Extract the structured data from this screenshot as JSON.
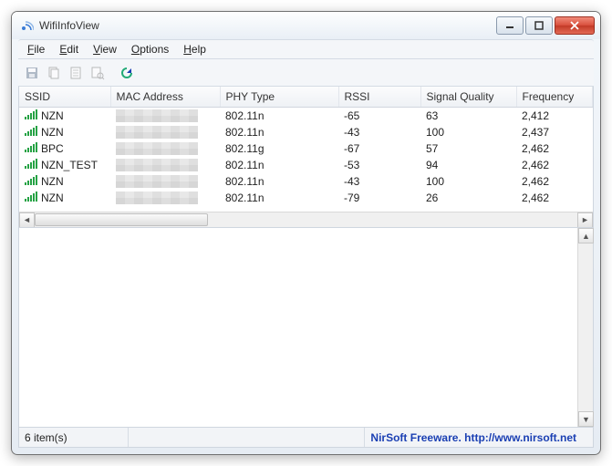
{
  "window": {
    "title": "WifiInfoView"
  },
  "menu": {
    "file": "File",
    "edit": "Edit",
    "view": "View",
    "options": "Options",
    "help": "Help"
  },
  "columns": {
    "ssid": "SSID",
    "mac": "MAC Address",
    "phy": "PHY Type",
    "rssi": "RSSI",
    "quality": "Signal Quality",
    "freq": "Frequency"
  },
  "rows": [
    {
      "ssid": "NZN",
      "phy": "802.11n",
      "rssi": "-65",
      "quality": "63",
      "freq": "2,412"
    },
    {
      "ssid": "NZN",
      "phy": "802.11n",
      "rssi": "-43",
      "quality": "100",
      "freq": "2,437"
    },
    {
      "ssid": "BPC",
      "phy": "802.11g",
      "rssi": "-67",
      "quality": "57",
      "freq": "2,462"
    },
    {
      "ssid": "NZN_TEST",
      "phy": "802.11n",
      "rssi": "-53",
      "quality": "94",
      "freq": "2,462"
    },
    {
      "ssid": "NZN",
      "phy": "802.11n",
      "rssi": "-43",
      "quality": "100",
      "freq": "2,462"
    },
    {
      "ssid": "NZN",
      "phy": "802.11n",
      "rssi": "-79",
      "quality": "26",
      "freq": "2,462"
    }
  ],
  "status": {
    "count": "6 item(s)",
    "credit": "NirSoft Freeware.  http://www.nirsoft.net"
  }
}
